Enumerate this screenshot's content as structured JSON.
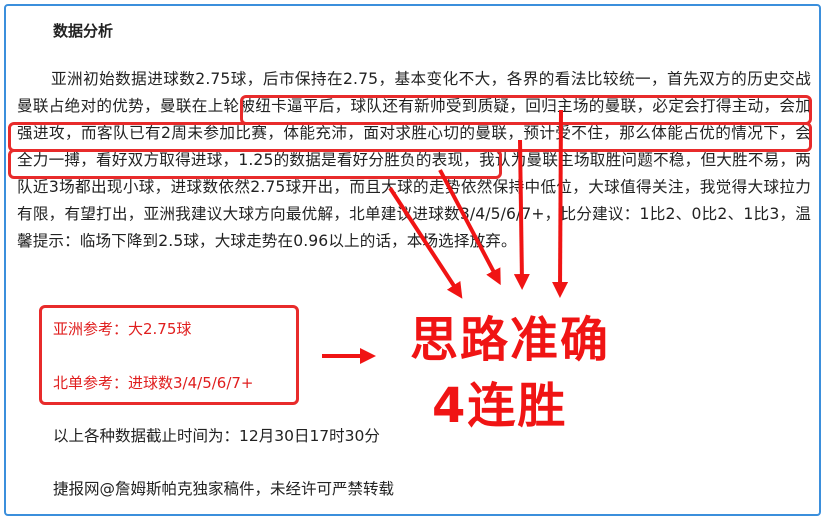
{
  "article": {
    "heading": "数据分析",
    "paragraph": "亚洲初始数据进球数2.75球，后市保持在2.75，基本变化不大，各界的看法比较统一，首先双方的历史交战曼联占绝对的优势，曼联在上轮被纽卡逼平后，球队还有新帅受到质疑，回归主场的曼联，必定会打得主动，会加强进攻，而客队已有2周未参加比赛，体能充沛，面对求胜心切的曼联，预计受不住，那么体能占优的情况下，会全力一搏，看好双方取得进球，1.25的数据是看好分胜负的表现，我认为曼联主场取胜问题不稳，但大胜不易，两队近3场都出现小球，进球数依然2.75球开出，而且大球的走势依然保持中低位，大球值得关注，我觉得大球拉力有限，有望打出，亚洲我建议大球方向最优解，北单建议进球数3/4/5/6/7+，比分建议：1比2、0比2、1比3，温馨提示：临场下降到2.5球，大球走势在0.96以上的话，本场选择放弃。",
    "asia_ref": "亚洲参考：大2.75球",
    "beidan_ref": "北单参考：进球数3/4/5/6/7+",
    "deadline": "以上各种数据截止时间为：12月30日17时30分",
    "copyright": "捷报网@詹姆斯帕克独家稿件，未经许可严禁转载"
  },
  "overlay": {
    "line1": "思路准确",
    "line2": "4连胜"
  },
  "colors": {
    "frame": "#3b8fdc",
    "highlight": "#e82b2b",
    "overlay_text": "#f01414"
  }
}
